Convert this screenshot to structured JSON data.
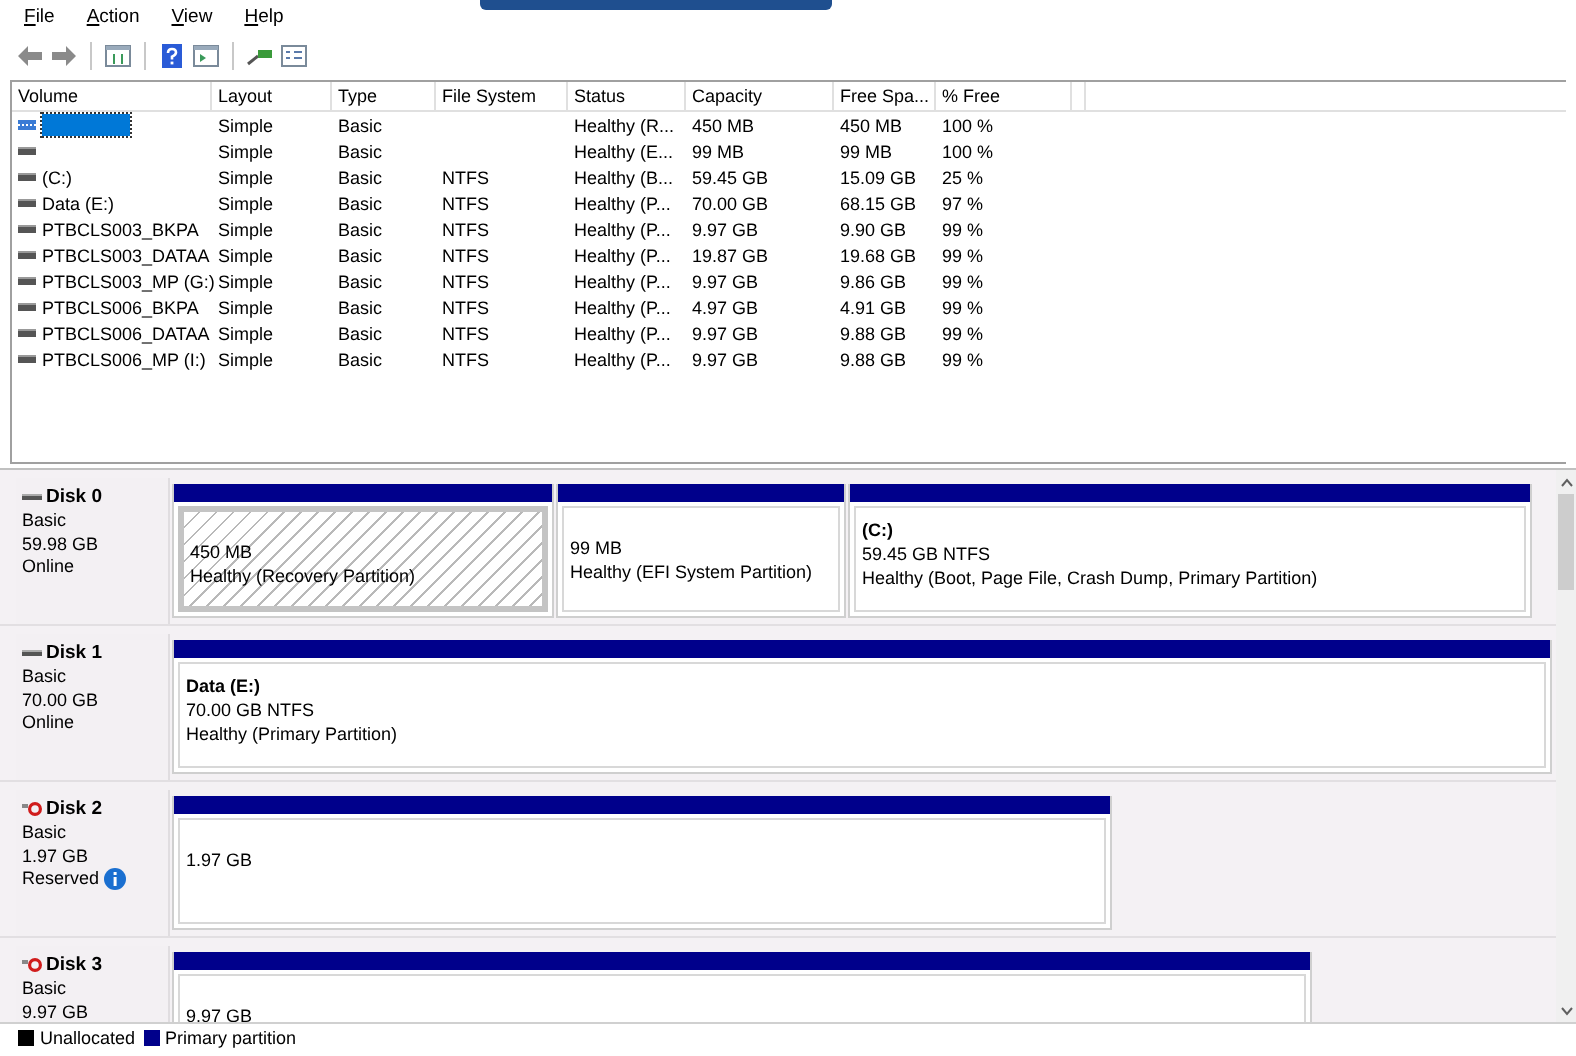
{
  "menu": [
    "File",
    "Action",
    "View",
    "Help"
  ],
  "volume_list": {
    "columns": [
      "Volume",
      "Layout",
      "Type",
      "File System",
      "Status",
      "Capacity",
      "Free Spa...",
      "% Free"
    ],
    "rows": [
      {
        "selected": true,
        "cells": [
          "",
          "Simple",
          "Basic",
          "",
          "Healthy (R...",
          "450 MB",
          "450 MB",
          "100 %"
        ]
      },
      {
        "selected": false,
        "cells": [
          "",
          "Simple",
          "Basic",
          "",
          "Healthy (E...",
          "99 MB",
          "99 MB",
          "100 %"
        ]
      },
      {
        "selected": false,
        "cells": [
          "(C:)",
          "Simple",
          "Basic",
          "NTFS",
          "Healthy (B...",
          "59.45 GB",
          "15.09 GB",
          "25 %"
        ]
      },
      {
        "selected": false,
        "cells": [
          "Data (E:)",
          "Simple",
          "Basic",
          "NTFS",
          "Healthy (P...",
          "70.00 GB",
          "68.15 GB",
          "97 %"
        ]
      },
      {
        "selected": false,
        "cells": [
          "PTBCLS003_BKPA",
          "Simple",
          "Basic",
          "NTFS",
          "Healthy (P...",
          "9.97 GB",
          "9.90 GB",
          "99 %"
        ]
      },
      {
        "selected": false,
        "cells": [
          "PTBCLS003_DATAA",
          "Simple",
          "Basic",
          "NTFS",
          "Healthy (P...",
          "19.87 GB",
          "19.68 GB",
          "99 %"
        ]
      },
      {
        "selected": false,
        "cells": [
          "PTBCLS003_MP (G:)",
          "Simple",
          "Basic",
          "NTFS",
          "Healthy (P...",
          "9.97 GB",
          "9.86 GB",
          "99 %"
        ]
      },
      {
        "selected": false,
        "cells": [
          "PTBCLS006_BKPA",
          "Simple",
          "Basic",
          "NTFS",
          "Healthy (P...",
          "4.97 GB",
          "4.91 GB",
          "99 %"
        ]
      },
      {
        "selected": false,
        "cells": [
          "PTBCLS006_DATAA",
          "Simple",
          "Basic",
          "NTFS",
          "Healthy (P...",
          "9.97 GB",
          "9.88 GB",
          "99 %"
        ]
      },
      {
        "selected": false,
        "cells": [
          "PTBCLS006_MP (I:)",
          "Simple",
          "Basic",
          "NTFS",
          "Healthy (P...",
          "9.97 GB",
          "9.88 GB",
          "99 %"
        ]
      }
    ]
  },
  "disks": [
    {
      "name": "Disk 0",
      "offline": false,
      "info": false,
      "lines": [
        "Basic",
        "59.98 GB",
        "Online"
      ],
      "partitions": [
        {
          "selected": true,
          "lines": [
            "450 MB",
            "Healthy (Recovery Partition)"
          ]
        },
        {
          "selected": false,
          "lines": [
            "99 MB",
            "Healthy (EFI System Partition)"
          ]
        },
        {
          "selected": false,
          "label": "(C:)",
          "lines": [
            "59.45 GB NTFS",
            "Healthy (Boot, Page File, Crash Dump, Primary Partition)"
          ]
        }
      ]
    },
    {
      "name": "Disk 1",
      "offline": false,
      "info": false,
      "lines": [
        "Basic",
        "70.00 GB",
        "Online"
      ],
      "partitions": [
        {
          "selected": false,
          "label": "Data  (E:)",
          "lines": [
            "70.00 GB NTFS",
            "Healthy (Primary Partition)"
          ]
        }
      ]
    },
    {
      "name": "Disk 2",
      "offline": true,
      "info": true,
      "lines": [
        "Basic",
        "1.97 GB",
        "Reserved"
      ],
      "partitions": [
        {
          "selected": false,
          "lines": [
            "1.97 GB"
          ]
        }
      ]
    },
    {
      "name": "Disk 3",
      "offline": true,
      "info": false,
      "lines": [
        "Basic",
        "9.97 GB"
      ],
      "partitions": [
        {
          "selected": false,
          "lines": [
            "9.97 GB"
          ]
        }
      ]
    }
  ],
  "legend": [
    {
      "label": "Unallocated",
      "color": "#000000"
    },
    {
      "label": "Primary partition",
      "color": "#00008b"
    }
  ]
}
